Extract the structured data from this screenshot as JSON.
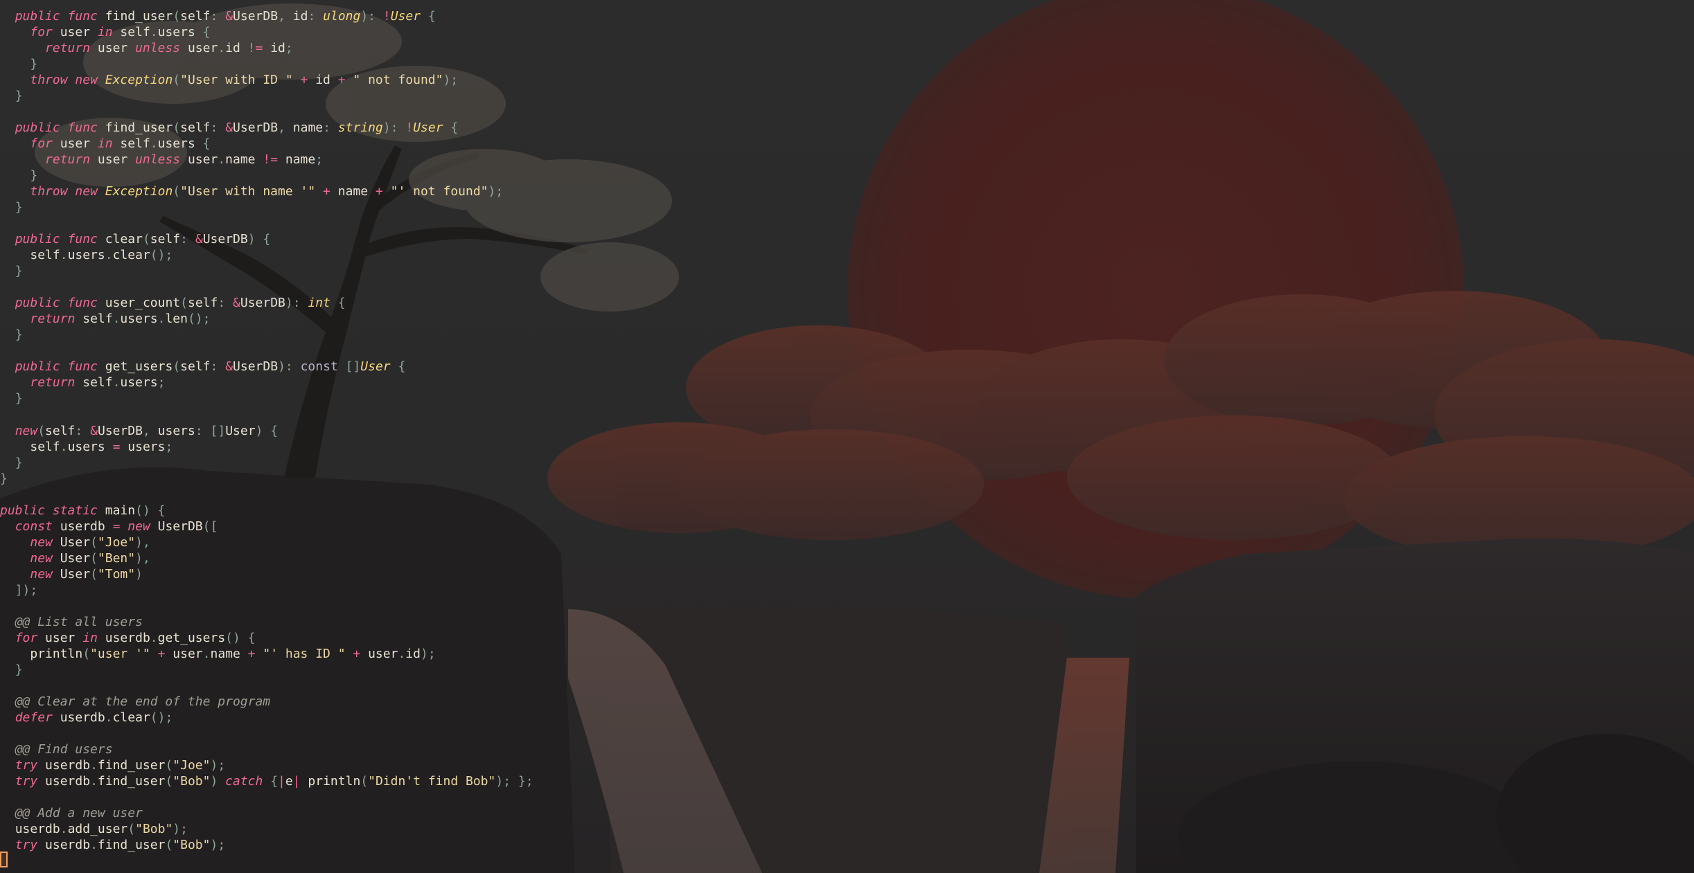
{
  "colors": {
    "keyword": "#f06a93",
    "type": "#f6d77a",
    "string": "#ebd8a4",
    "punctuation": "#8fa79c",
    "comment": "#a09d94",
    "text": "#e6e1d4",
    "cursor": "#f0a060",
    "sun": "#8e2a1f"
  },
  "wallpaper": {
    "description_icon": "sunset-waterfall-landscape"
  },
  "editor": {
    "lines": [
      [
        [
          "  ",
          "text"
        ],
        [
          "public",
          "kw"
        ],
        [
          " ",
          "text"
        ],
        [
          "func",
          "kw"
        ],
        [
          " ",
          "text"
        ],
        [
          "find_user",
          "fn"
        ],
        [
          "(",
          "punct"
        ],
        [
          "self",
          "text"
        ],
        [
          ": ",
          "punct"
        ],
        [
          "&",
          "op"
        ],
        [
          "UserDB",
          "text"
        ],
        [
          ", ",
          "punct"
        ],
        [
          "id",
          "text"
        ],
        [
          ": ",
          "punct"
        ],
        [
          "ulong",
          "type"
        ],
        [
          "): ",
          "punct"
        ],
        [
          "!",
          "op"
        ],
        [
          "User",
          "type"
        ],
        [
          " {",
          "punct"
        ]
      ],
      [
        [
          "    ",
          "text"
        ],
        [
          "for",
          "kw"
        ],
        [
          " user ",
          "text"
        ],
        [
          "in",
          "kw"
        ],
        [
          " self",
          "text"
        ],
        [
          ".",
          "punct"
        ],
        [
          "users",
          "text"
        ],
        [
          " {",
          "punct"
        ]
      ],
      [
        [
          "      ",
          "text"
        ],
        [
          "return",
          "kw"
        ],
        [
          " user ",
          "text"
        ],
        [
          "unless",
          "kw"
        ],
        [
          " user",
          "text"
        ],
        [
          ".",
          "punct"
        ],
        [
          "id ",
          "text"
        ],
        [
          "!=",
          "op"
        ],
        [
          " id",
          "text"
        ],
        [
          ";",
          "punct"
        ]
      ],
      [
        [
          "    ",
          "text"
        ],
        [
          "}",
          "punct"
        ]
      ],
      [
        [
          "    ",
          "text"
        ],
        [
          "throw",
          "kw"
        ],
        [
          " ",
          "text"
        ],
        [
          "new",
          "kw"
        ],
        [
          " ",
          "text"
        ],
        [
          "Exception",
          "type"
        ],
        [
          "(",
          "punct"
        ],
        [
          "\"User with ID \"",
          "str"
        ],
        [
          " + ",
          "op"
        ],
        [
          "id",
          "text"
        ],
        [
          " + ",
          "op"
        ],
        [
          "\" not found\"",
          "str"
        ],
        [
          ");",
          "punct"
        ]
      ],
      [
        [
          "  ",
          "text"
        ],
        [
          "}",
          "punct"
        ]
      ],
      [
        [
          "",
          "text"
        ]
      ],
      [
        [
          "  ",
          "text"
        ],
        [
          "public",
          "kw"
        ],
        [
          " ",
          "text"
        ],
        [
          "func",
          "kw"
        ],
        [
          " ",
          "text"
        ],
        [
          "find_user",
          "fn"
        ],
        [
          "(",
          "punct"
        ],
        [
          "self",
          "text"
        ],
        [
          ": ",
          "punct"
        ],
        [
          "&",
          "op"
        ],
        [
          "UserDB",
          "text"
        ],
        [
          ", ",
          "punct"
        ],
        [
          "name",
          "text"
        ],
        [
          ": ",
          "punct"
        ],
        [
          "string",
          "type"
        ],
        [
          "): ",
          "punct"
        ],
        [
          "!",
          "op"
        ],
        [
          "User",
          "type"
        ],
        [
          " {",
          "punct"
        ]
      ],
      [
        [
          "    ",
          "text"
        ],
        [
          "for",
          "kw"
        ],
        [
          " user ",
          "text"
        ],
        [
          "in",
          "kw"
        ],
        [
          " self",
          "text"
        ],
        [
          ".",
          "punct"
        ],
        [
          "users",
          "text"
        ],
        [
          " {",
          "punct"
        ]
      ],
      [
        [
          "      ",
          "text"
        ],
        [
          "return",
          "kw"
        ],
        [
          " user ",
          "text"
        ],
        [
          "unless",
          "kw"
        ],
        [
          " user",
          "text"
        ],
        [
          ".",
          "punct"
        ],
        [
          "name ",
          "text"
        ],
        [
          "!=",
          "op"
        ],
        [
          " name",
          "text"
        ],
        [
          ";",
          "punct"
        ]
      ],
      [
        [
          "    ",
          "text"
        ],
        [
          "}",
          "punct"
        ]
      ],
      [
        [
          "    ",
          "text"
        ],
        [
          "throw",
          "kw"
        ],
        [
          " ",
          "text"
        ],
        [
          "new",
          "kw"
        ],
        [
          " ",
          "text"
        ],
        [
          "Exception",
          "type"
        ],
        [
          "(",
          "punct"
        ],
        [
          "\"User with name '\"",
          "str"
        ],
        [
          " + ",
          "op"
        ],
        [
          "name",
          "text"
        ],
        [
          " + ",
          "op"
        ],
        [
          "\"' not found\"",
          "str"
        ],
        [
          ");",
          "punct"
        ]
      ],
      [
        [
          "  ",
          "text"
        ],
        [
          "}",
          "punct"
        ]
      ],
      [
        [
          "",
          "text"
        ]
      ],
      [
        [
          "  ",
          "text"
        ],
        [
          "public",
          "kw"
        ],
        [
          " ",
          "text"
        ],
        [
          "func",
          "kw"
        ],
        [
          " ",
          "text"
        ],
        [
          "clear",
          "fn"
        ],
        [
          "(",
          "punct"
        ],
        [
          "self",
          "text"
        ],
        [
          ": ",
          "punct"
        ],
        [
          "&",
          "op"
        ],
        [
          "UserDB",
          "text"
        ],
        [
          ") {",
          "punct"
        ]
      ],
      [
        [
          "    ",
          "text"
        ],
        [
          "self",
          "text"
        ],
        [
          ".",
          "punct"
        ],
        [
          "users",
          "text"
        ],
        [
          ".",
          "punct"
        ],
        [
          "clear",
          "fn"
        ],
        [
          "();",
          "punct"
        ]
      ],
      [
        [
          "  ",
          "text"
        ],
        [
          "}",
          "punct"
        ]
      ],
      [
        [
          "",
          "text"
        ]
      ],
      [
        [
          "  ",
          "text"
        ],
        [
          "public",
          "kw"
        ],
        [
          " ",
          "text"
        ],
        [
          "func",
          "kw"
        ],
        [
          " ",
          "text"
        ],
        [
          "user_count",
          "fn"
        ],
        [
          "(",
          "punct"
        ],
        [
          "self",
          "text"
        ],
        [
          ": ",
          "punct"
        ],
        [
          "&",
          "op"
        ],
        [
          "UserDB",
          "text"
        ],
        [
          "): ",
          "punct"
        ],
        [
          "int",
          "type"
        ],
        [
          " {",
          "punct"
        ]
      ],
      [
        [
          "    ",
          "text"
        ],
        [
          "return",
          "kw"
        ],
        [
          " self",
          "text"
        ],
        [
          ".",
          "punct"
        ],
        [
          "users",
          "text"
        ],
        [
          ".",
          "punct"
        ],
        [
          "len",
          "fn"
        ],
        [
          "();",
          "punct"
        ]
      ],
      [
        [
          "  ",
          "text"
        ],
        [
          "}",
          "punct"
        ]
      ],
      [
        [
          "",
          "text"
        ]
      ],
      [
        [
          "  ",
          "text"
        ],
        [
          "public",
          "kw"
        ],
        [
          " ",
          "text"
        ],
        [
          "func",
          "kw"
        ],
        [
          " ",
          "text"
        ],
        [
          "get_users",
          "fn"
        ],
        [
          "(",
          "punct"
        ],
        [
          "self",
          "text"
        ],
        [
          ": ",
          "punct"
        ],
        [
          "&",
          "op"
        ],
        [
          "UserDB",
          "text"
        ],
        [
          "): ",
          "punct"
        ],
        [
          "const",
          "const"
        ],
        [
          " []",
          "punct"
        ],
        [
          "User",
          "type"
        ],
        [
          " {",
          "punct"
        ]
      ],
      [
        [
          "    ",
          "text"
        ],
        [
          "return",
          "kw"
        ],
        [
          " self",
          "text"
        ],
        [
          ".",
          "punct"
        ],
        [
          "users",
          "text"
        ],
        [
          ";",
          "punct"
        ]
      ],
      [
        [
          "  ",
          "text"
        ],
        [
          "}",
          "punct"
        ]
      ],
      [
        [
          "",
          "text"
        ]
      ],
      [
        [
          "  ",
          "text"
        ],
        [
          "new",
          "kw"
        ],
        [
          "(",
          "punct"
        ],
        [
          "self",
          "text"
        ],
        [
          ": ",
          "punct"
        ],
        [
          "&",
          "op"
        ],
        [
          "UserDB",
          "text"
        ],
        [
          ", ",
          "punct"
        ],
        [
          "users",
          "text"
        ],
        [
          ": ",
          "punct"
        ],
        [
          "[]",
          "punct"
        ],
        [
          "User",
          "text"
        ],
        [
          ") {",
          "punct"
        ]
      ],
      [
        [
          "    ",
          "text"
        ],
        [
          "self",
          "text"
        ],
        [
          ".",
          "punct"
        ],
        [
          "users ",
          "text"
        ],
        [
          "=",
          "op"
        ],
        [
          " users",
          "text"
        ],
        [
          ";",
          "punct"
        ]
      ],
      [
        [
          "  ",
          "text"
        ],
        [
          "}",
          "punct"
        ]
      ],
      [
        [
          "}",
          "punct"
        ]
      ],
      [
        [
          "",
          "text"
        ]
      ],
      [
        [
          "public",
          "kw"
        ],
        [
          " ",
          "text"
        ],
        [
          "static",
          "kw"
        ],
        [
          " ",
          "text"
        ],
        [
          "main",
          "fn"
        ],
        [
          "() {",
          "punct"
        ]
      ],
      [
        [
          "  ",
          "text"
        ],
        [
          "const",
          "kw"
        ],
        [
          " userdb ",
          "text"
        ],
        [
          "=",
          "op"
        ],
        [
          " ",
          "text"
        ],
        [
          "new",
          "kw"
        ],
        [
          " ",
          "text"
        ],
        [
          "UserDB",
          "text"
        ],
        [
          "([",
          "punct"
        ]
      ],
      [
        [
          "    ",
          "text"
        ],
        [
          "new",
          "kw"
        ],
        [
          " ",
          "text"
        ],
        [
          "User",
          "text"
        ],
        [
          "(",
          "punct"
        ],
        [
          "\"Joe\"",
          "str"
        ],
        [
          "),",
          "punct"
        ]
      ],
      [
        [
          "    ",
          "text"
        ],
        [
          "new",
          "kw"
        ],
        [
          " ",
          "text"
        ],
        [
          "User",
          "text"
        ],
        [
          "(",
          "punct"
        ],
        [
          "\"Ben\"",
          "str"
        ],
        [
          "),",
          "punct"
        ]
      ],
      [
        [
          "    ",
          "text"
        ],
        [
          "new",
          "kw"
        ],
        [
          " ",
          "text"
        ],
        [
          "User",
          "text"
        ],
        [
          "(",
          "punct"
        ],
        [
          "\"Tom\"",
          "str"
        ],
        [
          ")",
          "punct"
        ]
      ],
      [
        [
          "  ",
          "text"
        ],
        [
          "]);",
          "punct"
        ]
      ],
      [
        [
          "",
          "text"
        ]
      ],
      [
        [
          "  ",
          "text"
        ],
        [
          "@@ List all users",
          "comment"
        ]
      ],
      [
        [
          "  ",
          "text"
        ],
        [
          "for",
          "kw"
        ],
        [
          " user ",
          "text"
        ],
        [
          "in",
          "kw"
        ],
        [
          " userdb",
          "text"
        ],
        [
          ".",
          "punct"
        ],
        [
          "get_users",
          "fn"
        ],
        [
          "() {",
          "punct"
        ]
      ],
      [
        [
          "    ",
          "text"
        ],
        [
          "println",
          "fn"
        ],
        [
          "(",
          "punct"
        ],
        [
          "\"user '\"",
          "str"
        ],
        [
          " + ",
          "op"
        ],
        [
          "user",
          "text"
        ],
        [
          ".",
          "punct"
        ],
        [
          "name",
          "text"
        ],
        [
          " + ",
          "op"
        ],
        [
          "\"' has ID \"",
          "str"
        ],
        [
          " + ",
          "op"
        ],
        [
          "user",
          "text"
        ],
        [
          ".",
          "punct"
        ],
        [
          "id",
          "text"
        ],
        [
          ");",
          "punct"
        ]
      ],
      [
        [
          "  ",
          "text"
        ],
        [
          "}",
          "punct"
        ]
      ],
      [
        [
          "",
          "text"
        ]
      ],
      [
        [
          "  ",
          "text"
        ],
        [
          "@@ Clear at the end of the program",
          "comment"
        ]
      ],
      [
        [
          "  ",
          "text"
        ],
        [
          "defer",
          "kw"
        ],
        [
          " userdb",
          "text"
        ],
        [
          ".",
          "punct"
        ],
        [
          "clear",
          "fn"
        ],
        [
          "();",
          "punct"
        ]
      ],
      [
        [
          "",
          "text"
        ]
      ],
      [
        [
          "  ",
          "text"
        ],
        [
          "@@ Find users",
          "comment"
        ]
      ],
      [
        [
          "  ",
          "text"
        ],
        [
          "try",
          "kw"
        ],
        [
          " userdb",
          "text"
        ],
        [
          ".",
          "punct"
        ],
        [
          "find_user",
          "fn"
        ],
        [
          "(",
          "punct"
        ],
        [
          "\"Joe\"",
          "str"
        ],
        [
          ");",
          "punct"
        ]
      ],
      [
        [
          "  ",
          "text"
        ],
        [
          "try",
          "kw"
        ],
        [
          " userdb",
          "text"
        ],
        [
          ".",
          "punct"
        ],
        [
          "find_user",
          "fn"
        ],
        [
          "(",
          "punct"
        ],
        [
          "\"Bob\"",
          "str"
        ],
        [
          ") ",
          "punct"
        ],
        [
          "catch",
          "kw"
        ],
        [
          " {",
          "punct"
        ],
        [
          "|",
          "op"
        ],
        [
          "e",
          "text"
        ],
        [
          "|",
          "op"
        ],
        [
          " ",
          "text"
        ],
        [
          "println",
          "fn"
        ],
        [
          "(",
          "punct"
        ],
        [
          "\"Didn't find Bob\"",
          "str"
        ],
        [
          "); };",
          "punct"
        ]
      ],
      [
        [
          "",
          "text"
        ]
      ],
      [
        [
          "  ",
          "text"
        ],
        [
          "@@ Add a new user",
          "comment"
        ]
      ],
      [
        [
          "  ",
          "text"
        ],
        [
          "userdb",
          "text"
        ],
        [
          ".",
          "punct"
        ],
        [
          "add_user",
          "fn"
        ],
        [
          "(",
          "punct"
        ],
        [
          "\"Bob\"",
          "str"
        ],
        [
          ");",
          "punct"
        ]
      ],
      [
        [
          "  ",
          "text"
        ],
        [
          "try",
          "kw"
        ],
        [
          " userdb",
          "text"
        ],
        [
          ".",
          "punct"
        ],
        [
          "find_user",
          "fn"
        ],
        [
          "(",
          "punct"
        ],
        [
          "\"Bob\"",
          "str"
        ],
        [
          ");",
          "punct"
        ]
      ]
    ]
  }
}
